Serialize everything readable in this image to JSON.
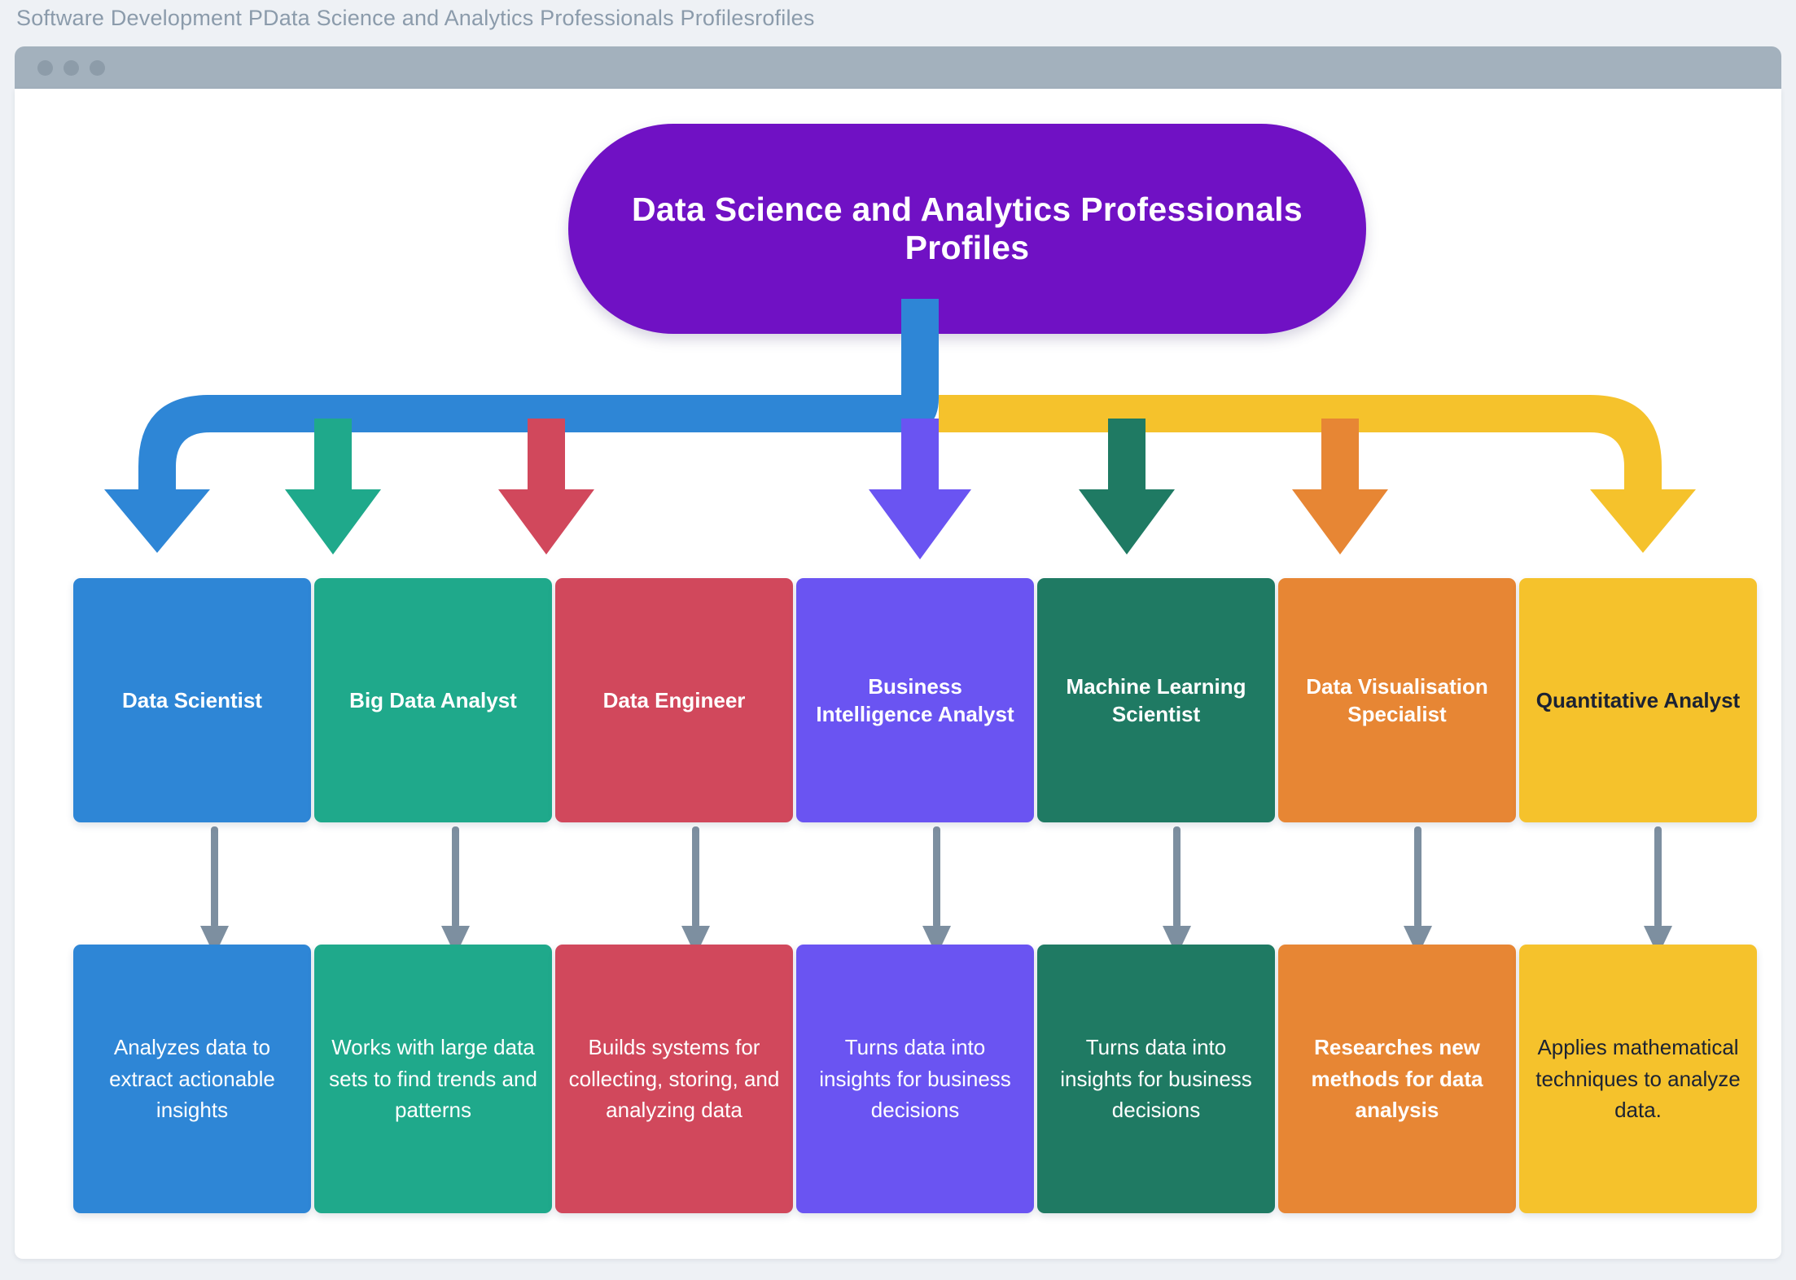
{
  "window": {
    "title": "Software Development PData Science and Analytics Professionals Profilesrofiles",
    "controls": [
      "close-dot",
      "minimize-dot",
      "maximize-dot"
    ],
    "titlebar_color": "#a3b1bd"
  },
  "diagram": {
    "type": "flowchart",
    "root": {
      "label": "Data Science and Analytics Professionals Profiles",
      "color": "#7011c4",
      "text_color": "#ffffff",
      "shape": "pill"
    },
    "trunk": {
      "left_branch_color": "#2e86d6",
      "right_branch_color": "#f5c22c"
    },
    "inter_row_arrow_color": "#7d8fa0",
    "nodes": [
      {
        "role": "Data Scientist",
        "description": "Analyzes data to extract actionable insights",
        "color": "#2e86d6",
        "text_color": "#ffffff",
        "desc_bold": false,
        "arrow_color": "#2e86d6"
      },
      {
        "role": "Big Data Analyst",
        "description": "Works with large data sets to find trends and patterns",
        "color": "#1fa98b",
        "text_color": "#ffffff",
        "desc_bold": false,
        "arrow_color": "#1fa98b"
      },
      {
        "role": "Data Engineer",
        "description": "Builds systems for collecting, storing, and analyzing data",
        "color": "#d1485c",
        "text_color": "#ffffff",
        "desc_bold": false,
        "arrow_color": "#d1485c"
      },
      {
        "role": "Business Intelligence Analyst",
        "description": "Turns data into insights for business decisions",
        "color": "#6a54f2",
        "text_color": "#ffffff",
        "desc_bold": false,
        "arrow_color": "#6a54f2"
      },
      {
        "role": "Machine Learning Scientist",
        "description": "Turns data into insights for business decisions",
        "color": "#1f7a63",
        "text_color": "#ffffff",
        "desc_bold": false,
        "arrow_color": "#1f7a63"
      },
      {
        "role": "Data Visualisation Specialist",
        "description": "Researches new methods for data analysis",
        "color": "#e78634",
        "text_color": "#ffffff",
        "desc_bold": true,
        "arrow_color": "#e78634"
      },
      {
        "role": "Quantitative Analyst",
        "description": "Applies mathematical techniques to analyze data.",
        "color": "#f5c22c",
        "text_color": "#1b2233",
        "desc_bold": false,
        "arrow_color": "#f5c22c"
      }
    ]
  }
}
